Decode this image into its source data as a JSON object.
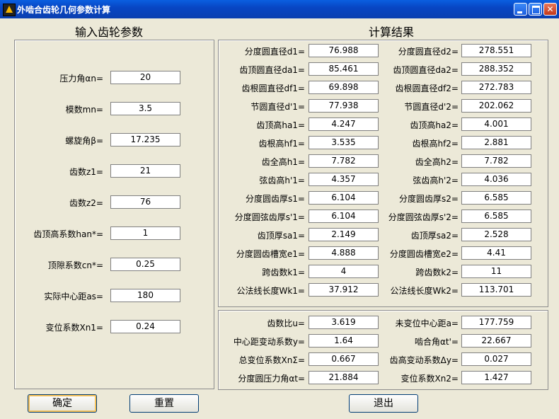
{
  "window": {
    "title": "外啮合齿轮几何参数计算"
  },
  "input": {
    "heading": "输入齿轮参数",
    "fields": [
      {
        "label": "压力角αn=",
        "value": "20"
      },
      {
        "label": "模数mn=",
        "value": "3.5"
      },
      {
        "label": "螺旋角β=",
        "value": "17.235"
      },
      {
        "label": "齿数z1=",
        "value": "21"
      },
      {
        "label": "齿数z2=",
        "value": "76"
      },
      {
        "label": "齿顶高系数han*=",
        "value": "1"
      },
      {
        "label": "顶隙系数cn*=",
        "value": "0.25"
      },
      {
        "label": "实际中心距as=",
        "value": "180"
      },
      {
        "label": "变位系数Xn1=",
        "value": "0.24"
      }
    ]
  },
  "results": {
    "heading": "计算结果",
    "rows": [
      {
        "l1": "分度圆直径d1=",
        "v1": "76.988",
        "l2": "分度圆直径d2=",
        "v2": "278.551"
      },
      {
        "l1": "齿顶圆直径da1=",
        "v1": "85.461",
        "l2": "齿顶圆直径da2=",
        "v2": "288.352"
      },
      {
        "l1": "齿根圆直径df1=",
        "v1": "69.898",
        "l2": "齿根圆直径df2=",
        "v2": "272.783"
      },
      {
        "l1": "节圆直径d'1=",
        "v1": "77.938",
        "l2": "节圆直径d'2=",
        "v2": "202.062"
      },
      {
        "l1": "齿顶高ha1=",
        "v1": "4.247",
        "l2": "齿顶高ha2=",
        "v2": "4.001"
      },
      {
        "l1": "齿根高hf1=",
        "v1": "3.535",
        "l2": "齿根高hf2=",
        "v2": "2.881"
      },
      {
        "l1": "齿全高h1=",
        "v1": "7.782",
        "l2": "齿全高h2=",
        "v2": "7.782"
      },
      {
        "l1": "弦齿高h'1=",
        "v1": "4.357",
        "l2": "弦齿高h'2=",
        "v2": "4.036"
      },
      {
        "l1": "分度圆齿厚s1=",
        "v1": "6.104",
        "l2": "分度圆齿厚s2=",
        "v2": "6.585"
      },
      {
        "l1": "分度圆弦齿厚s'1=",
        "v1": "6.104",
        "l2": "分度圆弦齿厚s'2=",
        "v2": "6.585"
      },
      {
        "l1": "齿顶厚sa1=",
        "v1": "2.149",
        "l2": "齿顶厚sa2=",
        "v2": "2.528"
      },
      {
        "l1": "分度圆齿槽宽e1=",
        "v1": "4.888",
        "l2": "分度圆齿槽宽e2=",
        "v2": "4.41"
      },
      {
        "l1": "跨齿数k1=",
        "v1": "4",
        "l2": "跨齿数k2=",
        "v2": "11"
      },
      {
        "l1": "公法线长度Wk1=",
        "v1": "37.912",
        "l2": "公法线长度Wk2=",
        "v2": "113.701"
      }
    ],
    "extra": [
      {
        "l1": "齿数比u=",
        "v1": "3.619",
        "l2": "未变位中心距a=",
        "v2": "177.759"
      },
      {
        "l1": "中心距变动系数y=",
        "v1": "1.64",
        "l2": "啮合角αt'=",
        "v2": "22.667"
      },
      {
        "l1": "总变位系数XnΣ=",
        "v1": "0.667",
        "l2": "齿高变动系数Δy=",
        "v2": "0.027"
      },
      {
        "l1": "分度圆压力角αt=",
        "v1": "21.884",
        "l2": "变位系数Xn2=",
        "v2": "1.427"
      }
    ]
  },
  "buttons": {
    "confirm": "确定",
    "reset": "重置",
    "exit": "退出"
  }
}
